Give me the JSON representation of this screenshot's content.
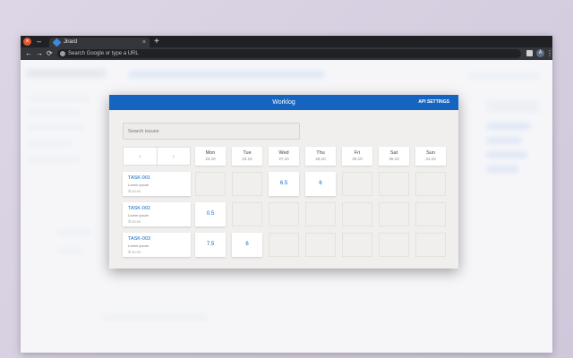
{
  "browser": {
    "tab_title": "Jirard",
    "tab_close": "×",
    "new_tab": "+",
    "omnibox_placeholder": "Search Google or type a URL",
    "avatar_letter": "A",
    "nav": {
      "back": "←",
      "forward": "→",
      "reload": "⟳"
    },
    "win_close": "×",
    "win_minimize": "–",
    "menu": "⋮"
  },
  "modal": {
    "title": "Worklog",
    "api_settings_label": "API SETTINGS",
    "search_placeholder": "Search issues",
    "pager": {
      "prev": "‹",
      "next": "›"
    },
    "days": [
      {
        "name": "Mon",
        "date": "22.10"
      },
      {
        "name": "Tue",
        "date": "23.10"
      },
      {
        "name": "Wed",
        "date": "27.10"
      },
      {
        "name": "Thu",
        "date": "28.10"
      },
      {
        "name": "Fri",
        "date": "29.10"
      },
      {
        "name": "Sat",
        "date": "30.10"
      },
      {
        "name": "Sun",
        "date": "31.10"
      }
    ],
    "tasks": [
      {
        "key": "TASK-001",
        "desc": "Lorem ipsum",
        "total": "⏱ 60:00",
        "hours": [
          "",
          "",
          "6.5",
          "6",
          "",
          "",
          ""
        ]
      },
      {
        "key": "TASK-002",
        "desc": "Lorem ipsum",
        "total": "⏱ 60:00",
        "hours": [
          "0.5",
          "",
          "",
          "",
          "",
          "",
          ""
        ]
      },
      {
        "key": "TASK-003",
        "desc": "Lorem ipsum",
        "total": "⏱ 60:00",
        "hours": [
          "7.5",
          "6",
          "",
          "",
          "",
          "",
          ""
        ]
      }
    ]
  },
  "colors": {
    "header": "#1565c0",
    "modal_bg": "#f0efed",
    "link": "#1565c0"
  }
}
